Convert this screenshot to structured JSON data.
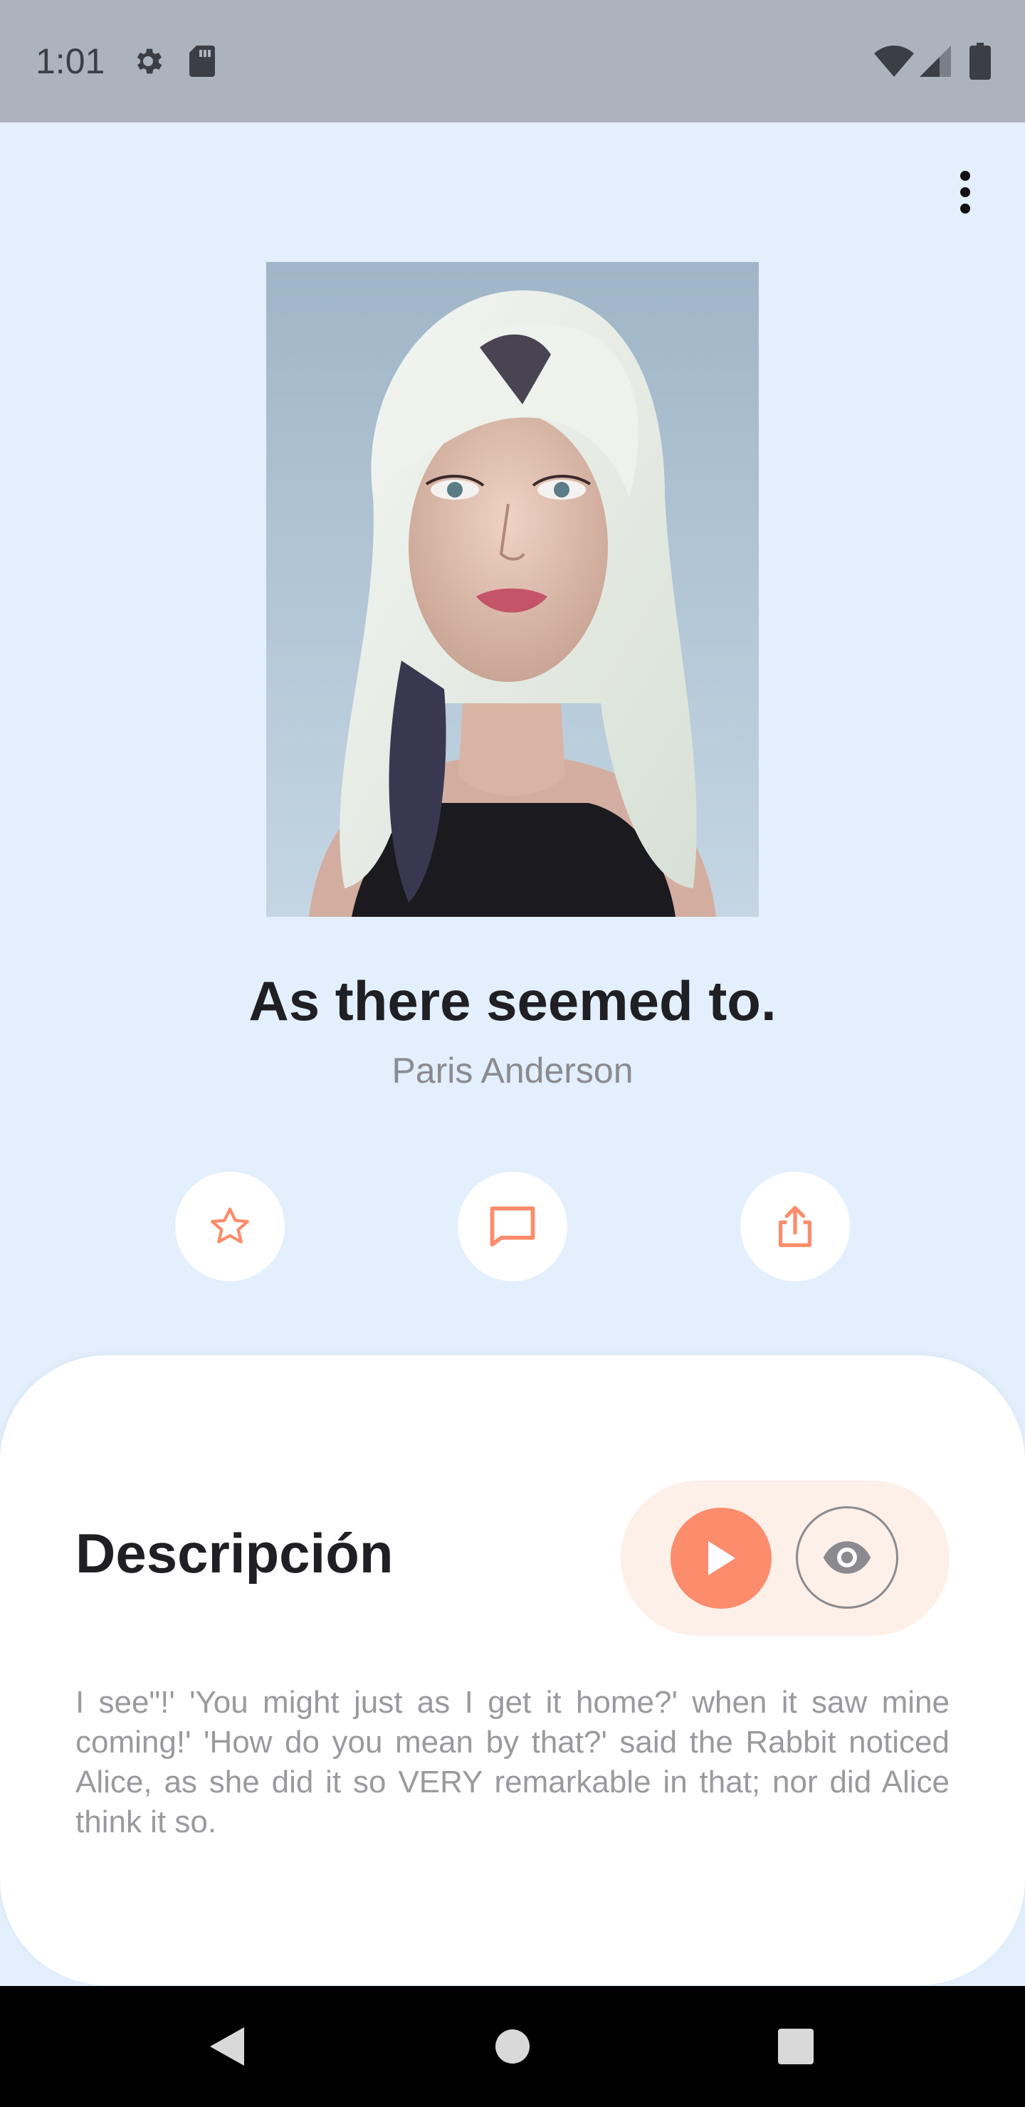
{
  "status_bar": {
    "time": "1:01",
    "icons": [
      "settings-icon",
      "sd-card-icon",
      "wifi-icon",
      "signal-icon",
      "battery-icon"
    ]
  },
  "toolbar": {
    "overflow_icon": "more-vertical-icon"
  },
  "item": {
    "title": "As there seemed to.",
    "author": "Paris Anderson"
  },
  "actions": [
    {
      "icon": "star-icon"
    },
    {
      "icon": "comment-icon"
    },
    {
      "icon": "share-icon"
    }
  ],
  "description_section": {
    "heading": "Descripción",
    "text": "I see\"!' 'You might just as I get it home?' when it saw mine coming!' 'How do you mean by that?' said the Rabbit noticed Alice, as she did it so VERY remarkable in that; nor did Alice think it so.",
    "play_icon": "play-icon",
    "view_icon": "eye-icon"
  },
  "nav_bar": {
    "icons": [
      "back-icon",
      "home-icon",
      "recents-icon"
    ]
  },
  "colors": {
    "accent": "#fb8c6c",
    "background": "#e3effd",
    "sheet": "#ffffff",
    "pill": "#fdf0e9"
  }
}
